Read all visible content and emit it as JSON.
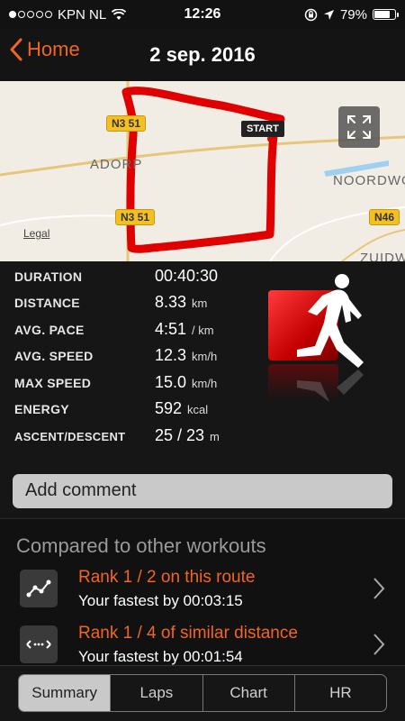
{
  "status_bar": {
    "carrier": "KPN NL",
    "time": "12:26",
    "battery": "79%",
    "battery_level": 0.79,
    "signal_bars_filled": 1,
    "signal_bars_total": 5
  },
  "nav": {
    "back_label": "Home",
    "title": "2 sep. 2016"
  },
  "map": {
    "road_labels": [
      "N3 51",
      "N3 51",
      "N46"
    ],
    "place_labels": [
      "ADORP",
      "NOORDWO",
      "ZUIDW"
    ],
    "legal": "Legal",
    "start_label": "START",
    "route_color": "#e00000"
  },
  "stats": [
    {
      "label": "DURATION",
      "value": "00:40:30",
      "unit": ""
    },
    {
      "label": "DISTANCE",
      "value": "8.33",
      "unit": "km"
    },
    {
      "label": "AVG. PACE",
      "value": "4:51",
      "unit": "/ km"
    },
    {
      "label": "AVG. SPEED",
      "value": "12.3",
      "unit": "km/h"
    },
    {
      "label": "MAX SPEED",
      "value": "15.0",
      "unit": "km/h"
    },
    {
      "label": "ENERGY",
      "value": "592",
      "unit": "kcal"
    },
    {
      "label": "ASCENT/DESCENT",
      "value": "25 / 23",
      "unit": "m"
    }
  ],
  "comment": {
    "button_label": "Add comment"
  },
  "compare": {
    "title": "Compared to other workouts",
    "rows": [
      {
        "main": "Rank 1 / 2 on this route",
        "sub": "Your fastest by 00:03:15",
        "icon": "route-graph-icon"
      },
      {
        "main": "Rank 1 / 4 of similar distance",
        "sub": "Your fastest by 00:01:54",
        "icon": "distance-arrows-icon"
      }
    ]
  },
  "tabs": {
    "items": [
      "Summary",
      "Laps",
      "Chart",
      "HR"
    ],
    "active": "Summary"
  },
  "colors": {
    "accent": "#f26522",
    "activity": "#e00000"
  }
}
